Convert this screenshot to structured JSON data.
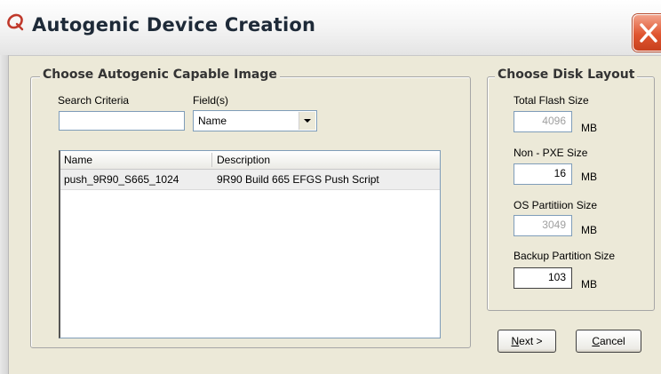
{
  "window": {
    "title": "Autogenic Device Creation",
    "accent_color": "#c0392b",
    "close_icon": "close-icon"
  },
  "image_group": {
    "legend": "Choose Autogenic Capable Image",
    "search_label": "Search Criteria",
    "search_value": "",
    "fields_label": "Field(s)",
    "fields_selected": "Name",
    "table": {
      "columns": [
        "Name",
        "Description"
      ],
      "rows": [
        {
          "name": "push_9R90_S665_1024",
          "description": "9R90 Build 665 EFGS Push Script"
        }
      ]
    }
  },
  "disk_group": {
    "legend": "Choose Disk Layout",
    "unit": "MB",
    "fields": [
      {
        "label": "Total Flash Size",
        "value": "4096",
        "enabled": false
      },
      {
        "label": "Non - PXE Size",
        "value": "16",
        "enabled": true
      },
      {
        "label": "OS Partitiion Size",
        "value": "3049",
        "enabled": false
      },
      {
        "label": "Backup Partition Size",
        "value": "103",
        "enabled": true
      }
    ]
  },
  "buttons": {
    "next_mnemonic": "N",
    "next_rest": "ext >",
    "cancel_mnemonic": "C",
    "cancel_rest": "ancel"
  }
}
